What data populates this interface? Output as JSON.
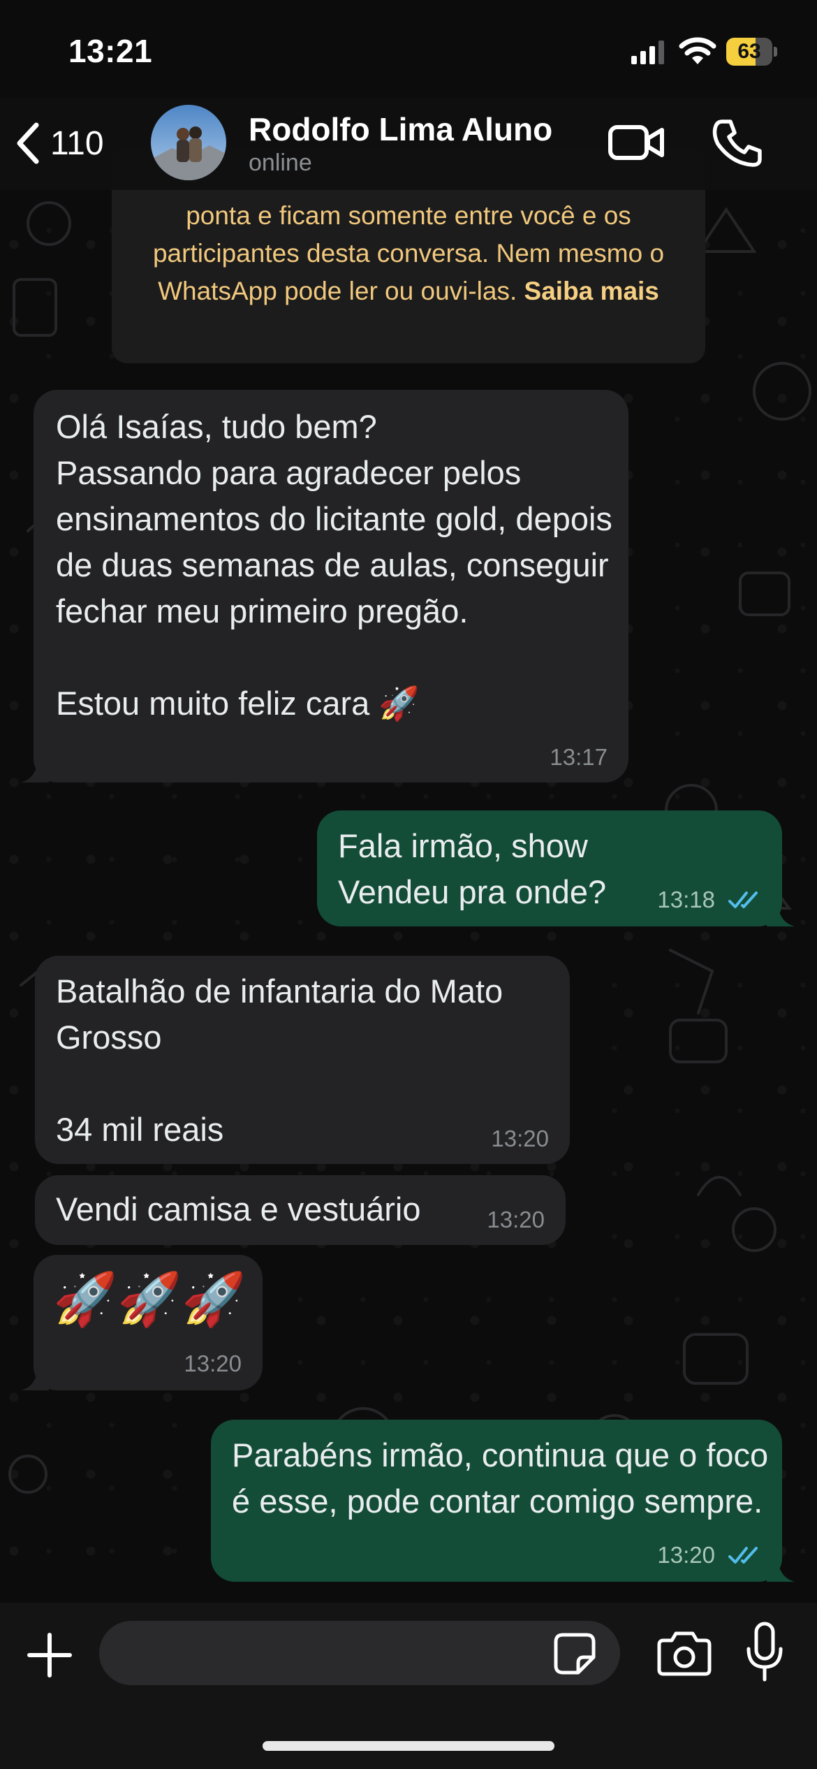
{
  "status_bar": {
    "time": "13:21",
    "battery_percent": 63,
    "battery_label": "63"
  },
  "header": {
    "back_count": "110",
    "contact_name": "Rodolfo Lima Aluno",
    "contact_status": "online"
  },
  "encryption_notice": {
    "text": "ponta e ficam somente entre você e os participantes desta conversa. Nem mesmo o WhatsApp pode ler ou ouvi-las. ",
    "link": "Saiba mais"
  },
  "messages": [
    {
      "direction": "incoming",
      "text": "Olá Isaías, tudo bem?\nPassando para agradecer pelos ensinamentos do licitante gold, depois de duas semanas de aulas, conseguir fechar meu primeiro pregão.\n\nEstou muito feliz cara 🚀",
      "time": "13:17"
    },
    {
      "direction": "outgoing",
      "text": "Fala irmão, show\nVendeu pra onde?",
      "time": "13:18",
      "read": true
    },
    {
      "direction": "incoming",
      "text": "Batalhão de infantaria do Mato Grosso\n\n34 mil reais",
      "time": "13:20"
    },
    {
      "direction": "incoming",
      "text": "Vendi camisa e vestuário",
      "time": "13:20"
    },
    {
      "direction": "incoming",
      "text": "🚀🚀🚀",
      "time": "13:20"
    },
    {
      "direction": "outgoing",
      "text": "Parabéns irmão, continua que o foco é esse, pode contar comigo sempre.",
      "time": "13:20",
      "read": true
    }
  ],
  "composer": {
    "placeholder": ""
  },
  "icons": {
    "back": "chevron-left-icon",
    "video": "video-camera-icon",
    "phone": "phone-icon",
    "attach": "plus-icon",
    "sticker": "sticker-icon",
    "camera": "camera-icon",
    "mic": "microphone-icon",
    "read_receipt": "double-check-icon"
  },
  "colors": {
    "incoming_bubble": "#232325",
    "outgoing_bubble": "#144d37",
    "read_ticks": "#53bdeb",
    "notice_text": "#f1c87d",
    "battery": "#f5cf3e"
  }
}
